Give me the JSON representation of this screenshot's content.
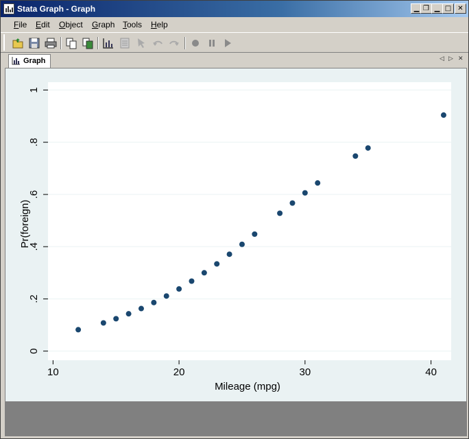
{
  "window": {
    "title": "Stata Graph - Graph"
  },
  "menu": [
    {
      "u": "F",
      "rest": "ile"
    },
    {
      "u": "E",
      "rest": "dit"
    },
    {
      "u": "O",
      "rest": "bject"
    },
    {
      "u": "G",
      "rest": "raph"
    },
    {
      "u": "T",
      "rest": "ools"
    },
    {
      "u": "H",
      "rest": "elp"
    }
  ],
  "tab": {
    "label": "Graph"
  },
  "colors": {
    "marker": "#1a476f",
    "plot_bg": "#ffffff",
    "outer_bg": "#eaf2f3",
    "grid": "#eaf2f3"
  },
  "chart_data": {
    "type": "scatter",
    "xlabel": "Mileage (mpg)",
    "ylabel": "Pr(foreign)",
    "xlim": [
      9.6,
      41.6
    ],
    "ylim": [
      -0.035,
      1.03
    ],
    "xticks": [
      10,
      20,
      30,
      40
    ],
    "xtick_labels": [
      "10",
      "20",
      "30",
      "40"
    ],
    "yticks": [
      0,
      0.2,
      0.4,
      0.6,
      0.8,
      1
    ],
    "ytick_labels": [
      "0",
      ".2",
      ".4",
      ".6",
      ".8",
      "1"
    ],
    "grid": "horizontal",
    "x": [
      12,
      14,
      15,
      16,
      17,
      18,
      19,
      20,
      21,
      22,
      23,
      24,
      25,
      26,
      28,
      29,
      30,
      31,
      34,
      35,
      41
    ],
    "y": [
      0.082,
      0.108,
      0.124,
      0.143,
      0.163,
      0.186,
      0.211,
      0.238,
      0.268,
      0.3,
      0.334,
      0.371,
      0.409,
      0.448,
      0.528,
      0.567,
      0.606,
      0.644,
      0.747,
      0.778,
      0.904
    ]
  }
}
